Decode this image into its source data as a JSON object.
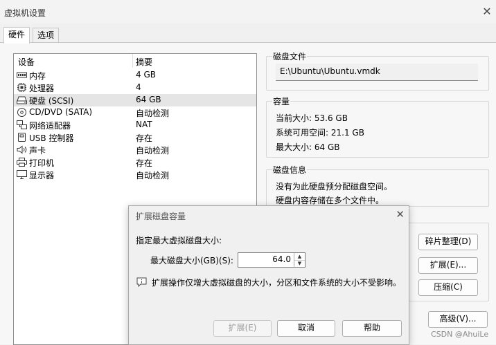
{
  "window": {
    "title": "虚拟机设置",
    "close_glyph": "✕"
  },
  "tabs": [
    {
      "label": "硬件"
    },
    {
      "label": "选项"
    }
  ],
  "device_list": {
    "col_device": "设备",
    "col_summary": "摘要",
    "items": [
      {
        "name": "内存",
        "summary": "4 GB",
        "icon": "memory-icon"
      },
      {
        "name": "处理器",
        "summary": "4",
        "icon": "processor-icon"
      },
      {
        "name": "硬盘 (SCSI)",
        "summary": "64 GB",
        "icon": "hard-disk-icon"
      },
      {
        "name": "CD/DVD (SATA)",
        "summary": "自动检测",
        "icon": "cd-dvd-icon"
      },
      {
        "name": "网络适配器",
        "summary": "NAT",
        "icon": "network-adapter-icon"
      },
      {
        "name": "USB 控制器",
        "summary": "存在",
        "icon": "usb-icon"
      },
      {
        "name": "声卡",
        "summary": "自动检测",
        "icon": "sound-card-icon"
      },
      {
        "name": "打印机",
        "summary": "存在",
        "icon": "printer-icon"
      },
      {
        "name": "显示器",
        "summary": "自动检测",
        "icon": "display-icon"
      }
    ],
    "selected_index": 2
  },
  "disk_file": {
    "title": "磁盘文件",
    "path": "E:\\Ubuntu\\Ubuntu.vmdk"
  },
  "capacity": {
    "title": "容量",
    "current": "当前大小: 53.6 GB",
    "available": "系统可用空间: 21.1 GB",
    "max": "最大大小: 64 GB"
  },
  "disk_info": {
    "title": "磁盘信息",
    "line1": "没有为此硬盘预分配磁盘空间。",
    "line2": "硬盘内容存储在多个文件中。"
  },
  "utilities": {
    "defrag": "碎片整理(D)",
    "expand": "扩展(E)...",
    "compact": "压缩(C)",
    "advanced": "高级(V)..."
  },
  "dialog": {
    "title": "扩展磁盘容量",
    "prompt": "指定最大虚拟磁盘大小:",
    "field_label": "最大磁盘大小(GB)(S):",
    "field_value": "64.0",
    "info": "扩展操作仅增大虚拟磁盘的大小，分区和文件系统的大小不受影响。",
    "btn_expand": "扩展(E)",
    "btn_cancel": "取消",
    "btn_help": "帮助"
  },
  "watermark": "CSDN @AhuiLe"
}
